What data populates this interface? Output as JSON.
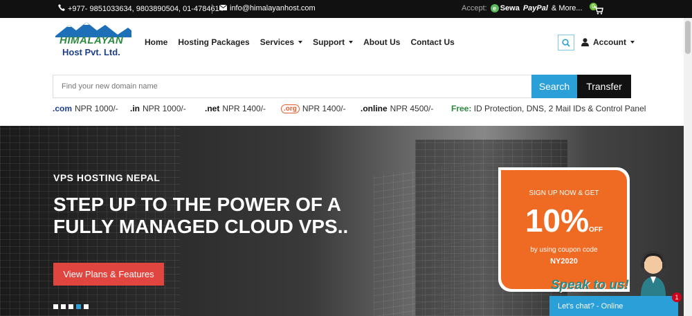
{
  "topbar": {
    "phone": "+977- 9851033634, 9803890504, 01-4784614",
    "email": "info@himalayanhost.com",
    "accept_label": "Accept:",
    "esewa": "Sewa",
    "paypal": "PayPal",
    "more": "& More...",
    "cart_count": "0"
  },
  "logo": {
    "line1": "HIMALAYAN",
    "line2": "Host Pvt. Ltd."
  },
  "nav": {
    "home": "Home",
    "hosting": "Hosting Packages",
    "services": "Services",
    "support": "Support",
    "about": "About Us",
    "contact": "Contact Us",
    "account": "Account"
  },
  "domain_search": {
    "placeholder": "Find your new domain name",
    "search_label": "Search",
    "transfer_label": "Transfer"
  },
  "tlds": [
    {
      "ext": ".com",
      "price": "NPR 1000/-"
    },
    {
      "ext": ".in",
      "price": "NPR 1000/-"
    },
    {
      "ext": ".net",
      "price": "NPR 1400/-"
    },
    {
      "ext": ".org",
      "price": "NPR 1400/-"
    },
    {
      "ext": ".online",
      "price": "NPR 4500/-"
    }
  ],
  "free": {
    "label": "Free:",
    "text": "ID Protection, DNS, 2 Mail IDs & Control Panel"
  },
  "hero": {
    "subtitle": "VPS HOSTING NEPAL",
    "headline": "STEP UP TO THE POWER OF A FULLY MANAGED CLOUD VPS..",
    "cta": "View Plans & Features",
    "slides": 5,
    "active_slide": 4
  },
  "promo": {
    "line1": "SIGN UP NOW & GET",
    "percent": "10%",
    "off": "OFF",
    "line3": "by using coupon code",
    "code": "NY2020"
  },
  "chat": {
    "speak": "Speak to us!",
    "status": "Let's chat? - Online",
    "badge": "1"
  },
  "colors": {
    "accent": "#2a9fd8",
    "cta": "#e0463f",
    "promo": "#ef6a22",
    "brand_green": "#2b8a3e"
  }
}
